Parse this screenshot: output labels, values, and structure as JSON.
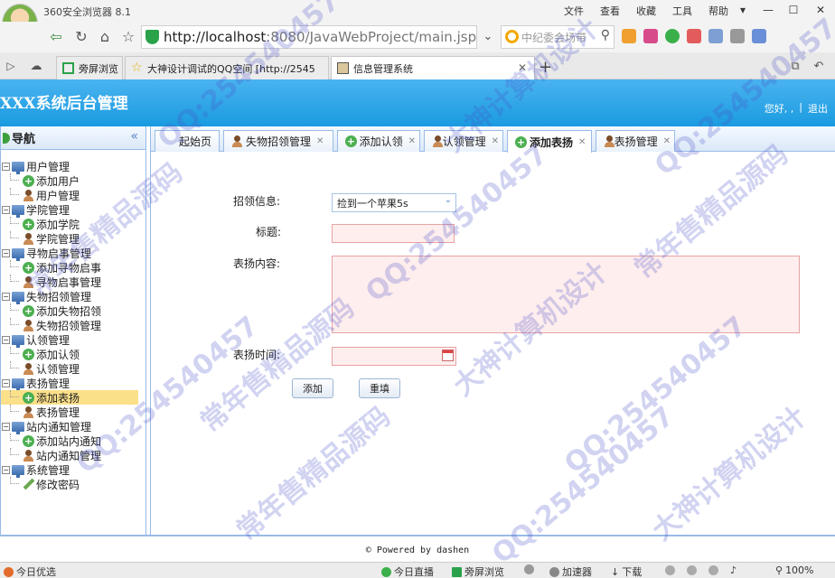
{
  "browser": {
    "name": "360安全浏览器 8.1",
    "menu": [
      "文件",
      "查看",
      "收藏",
      "工具",
      "帮助"
    ],
    "url_host": "http://localhost",
    "url_rest": ":8080/JavaWebProject/main.jsp",
    "search_placeholder": "中纪委会场带",
    "tabs": [
      {
        "label": "旁屏浏览"
      },
      {
        "label": "大神设计调试的QQ空间 [http://2545"
      },
      {
        "label": "信息管理系统"
      }
    ]
  },
  "app": {
    "title": "XXX系统后台管理",
    "user_greeting": "您好, ,",
    "logout": "退出"
  },
  "nav": {
    "title": "导航",
    "collapse_icon": "«",
    "groups": [
      {
        "label": "用户管理",
        "items": [
          "添加用户",
          "用户管理"
        ]
      },
      {
        "label": "学院管理",
        "items": [
          "添加学院",
          "学院管理"
        ]
      },
      {
        "label": "寻物启事管理",
        "items": [
          "添加寻物启事",
          "寻物启事管理"
        ]
      },
      {
        "label": "失物招领管理",
        "items": [
          "添加失物招领",
          "失物招领管理"
        ]
      },
      {
        "label": "认领管理",
        "items": [
          "添加认领",
          "认领管理"
        ]
      },
      {
        "label": "表扬管理",
        "items": [
          "添加表扬",
          "表扬管理"
        ]
      },
      {
        "label": "站内通知管理",
        "items": [
          "添加站内通知",
          "站内通知管理"
        ]
      },
      {
        "label": "系统管理",
        "items": [
          "修改密码"
        ]
      }
    ],
    "selected": "添加表扬"
  },
  "content_tabs": [
    {
      "label": "起始页",
      "icon": "none",
      "closable": false
    },
    {
      "label": "失物招领管理",
      "icon": "user-icon",
      "closable": true
    },
    {
      "label": "添加认领",
      "icon": "add-icon",
      "closable": true
    },
    {
      "label": "认领管理",
      "icon": "user-icon",
      "closable": true
    },
    {
      "label": "添加表扬",
      "icon": "add-icon",
      "closable": true,
      "active": true
    },
    {
      "label": "表扬管理",
      "icon": "user-icon",
      "closable": true
    }
  ],
  "form": {
    "lost_info_label": "招领信息:",
    "lost_info_value": "捡到一个苹果5s",
    "title_label": "标题:",
    "title_value": "",
    "content_label": "表扬内容:",
    "content_value": "",
    "time_label": "表扬时间:",
    "time_value": "",
    "add_button": "添加",
    "reset_button": "重填"
  },
  "footer": "© Powered by dashen",
  "statusbar": {
    "left": "今日优选",
    "items": [
      "今日直播",
      "旁屏浏览",
      "加速器",
      "下载"
    ],
    "zoom": "100%"
  },
  "watermarks": [
    "QQ:254540457",
    "大神计算机设计",
    "常年售精品源码"
  ]
}
